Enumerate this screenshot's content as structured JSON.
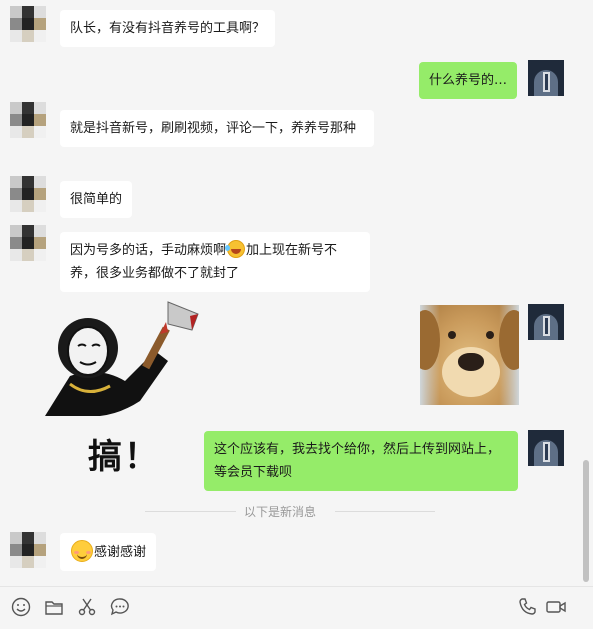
{
  "messages": [
    {
      "side": "left",
      "text": "队长，有没有抖音养号的工具啊？"
    },
    {
      "side": "right",
      "text": "什么养号的…"
    },
    {
      "side": "left",
      "text": "就是抖音新号，刷刷视频，评论一下，养养号那种"
    },
    {
      "side": "left",
      "text": "很简单的"
    },
    {
      "side": "left",
      "text_a": "因为号多的话，手动麻烦啊",
      "text_b": "加上现在新号不养，很多业务都做不了就封了"
    },
    {
      "side": "left",
      "sticker_text": "搞！"
    },
    {
      "side": "right",
      "image": "dog-photo"
    },
    {
      "side": "right",
      "text": "这个应该有，我去找个给你，然后上传到网站上，等会员下载呗"
    },
    {
      "side": "left",
      "text": "感谢感谢"
    }
  ],
  "divider": {
    "label": "以下是新消息"
  },
  "toolbar": {
    "left_icons": [
      "emoji-icon",
      "folder-icon",
      "scissors-icon",
      "chat-bubble-icon"
    ],
    "right_icons": [
      "phone-icon",
      "video-call-icon"
    ]
  },
  "colors": {
    "my_bubble": "#95ec69",
    "their_bubble": "#ffffff",
    "background": "#f5f5f5"
  }
}
